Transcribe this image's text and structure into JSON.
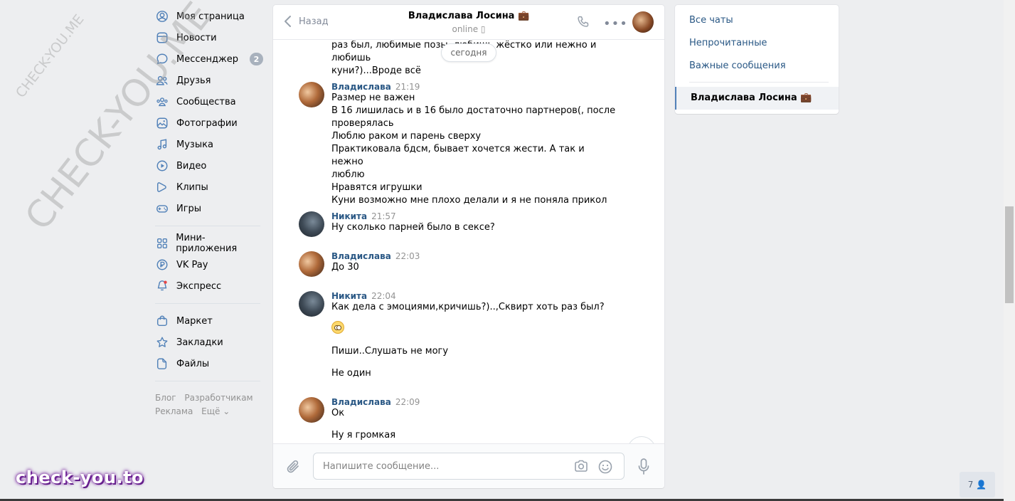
{
  "nav": {
    "items": [
      {
        "label": "Моя страница",
        "icon": "user-circle-icon"
      },
      {
        "label": "Новости",
        "icon": "news-icon"
      },
      {
        "label": "Мессенджер",
        "icon": "message-icon",
        "badge": "2"
      },
      {
        "label": "Друзья",
        "icon": "friends-icon"
      },
      {
        "label": "Сообщества",
        "icon": "communities-icon"
      },
      {
        "label": "Фотографии",
        "icon": "photo-icon"
      },
      {
        "label": "Музыка",
        "icon": "music-icon"
      },
      {
        "label": "Видео",
        "icon": "video-icon"
      },
      {
        "label": "Клипы",
        "icon": "clips-icon"
      },
      {
        "label": "Игры",
        "icon": "games-icon"
      }
    ],
    "items2": [
      {
        "label": "Мини-приложения",
        "icon": "apps-icon"
      },
      {
        "label": "VK Pay",
        "icon": "vkpay-icon"
      },
      {
        "label": "Экспресс",
        "icon": "express-icon"
      }
    ],
    "items3": [
      {
        "label": "Маркет",
        "icon": "market-icon"
      },
      {
        "label": "Закладки",
        "icon": "bookmark-icon"
      },
      {
        "label": "Файлы",
        "icon": "file-icon"
      }
    ],
    "footer": {
      "blog": "Блог",
      "developers": "Разработчикам",
      "ads": "Реклама",
      "more": "Ещё ⌄"
    }
  },
  "chat": {
    "back_label": "Назад",
    "peer_name": "Владислава Лосина 💼",
    "peer_status": "online ▯",
    "day_separator": "сегодня",
    "top_text": [
      "раз был, любимые позы, любишь жёстко или нежно и любишь",
      "куни?)...Вроде всё"
    ],
    "messages": [
      {
        "author": "Владислава",
        "time": "21:19",
        "lines": [
          "Размер не важен",
          "В 16 лишилась и в 16 было достаточно партнеров(, после",
          "проверялась",
          "Люблю раком и парень сверху",
          "Практиковала бдсм, бывает хочется жести. А так и нежно",
          "люблю",
          "Нравятся игрушки",
          "Куни возможно мне плохо делали и я не поняла прикол"
        ]
      },
      {
        "author": "Никита",
        "time": "21:57",
        "lines": [
          "Ну сколько парней было в сексе?"
        ]
      },
      {
        "author": "Владислава",
        "time": "22:03",
        "lines": [
          "До 30"
        ]
      },
      {
        "author": "Никита",
        "time": "22:04",
        "lines": [
          "Как дела с эмоциями,кричишь?)..,Сквирт хоть раз был?"
        ],
        "extra": [
          "Пиши..Слушать не могу",
          "Не один"
        ]
      },
      {
        "author": "Владислава",
        "time": "22:09",
        "lines": [
          "Ок"
        ],
        "extra": [
          "Ну я громкая"
        ]
      }
    ],
    "composer_placeholder": "Напишите сообщение..."
  },
  "right": {
    "folders": [
      "Все чаты",
      "Непрочитанные",
      "Важные сообщения"
    ],
    "active_chat": "Владислава Лосина 💼"
  },
  "watermark": {
    "small": "CHECK-YOU.ME",
    "large": "CHECK-YOU.ME",
    "brand": "check-you.to"
  },
  "online_count": "7 👤"
}
